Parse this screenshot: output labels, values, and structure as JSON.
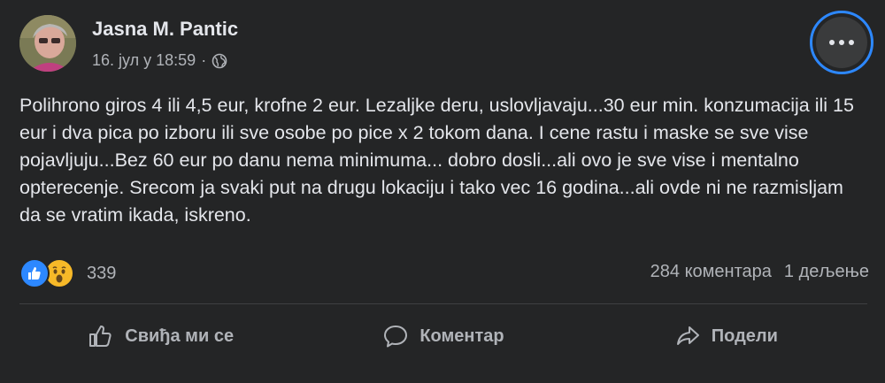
{
  "post": {
    "author": "Jasna M. Pantic",
    "date": "16. јул у 18:59",
    "separator": "·",
    "privacy_icon": "globe-icon",
    "text": "Polihrono giros 4 ili 4,5 eur, krofne 2 eur. Lezaljke deru, uslovljavaju...30 eur min. konzumacija ili 15 eur i dva pica po izboru ili sve osobe po pice x 2 tokom dana. I cene rastu i maske se sve vise pojavljuju...Bez 60 eur po danu nema minimuma... dobro dosli...ali ovo je sve vise i mentalno opterecenje. Srecom ja svaki put na drugu lokaciju i tako vec 16 godina...ali ovde ni ne razmisljam da se vratim ikada, iskreno."
  },
  "reactions": {
    "icons": [
      "like-icon",
      "wow-icon"
    ],
    "count": "339"
  },
  "stats": {
    "comments": "284 коментара",
    "shares": "1 дељење"
  },
  "actions": {
    "like": "Свиђа ми се",
    "comment": "Коментар",
    "share": "Подели"
  },
  "colors": {
    "background": "#242526",
    "text": "#e4e6eb",
    "secondary_text": "#b0b3b8",
    "accent": "#2d88ff",
    "wow": "#f7b928"
  }
}
